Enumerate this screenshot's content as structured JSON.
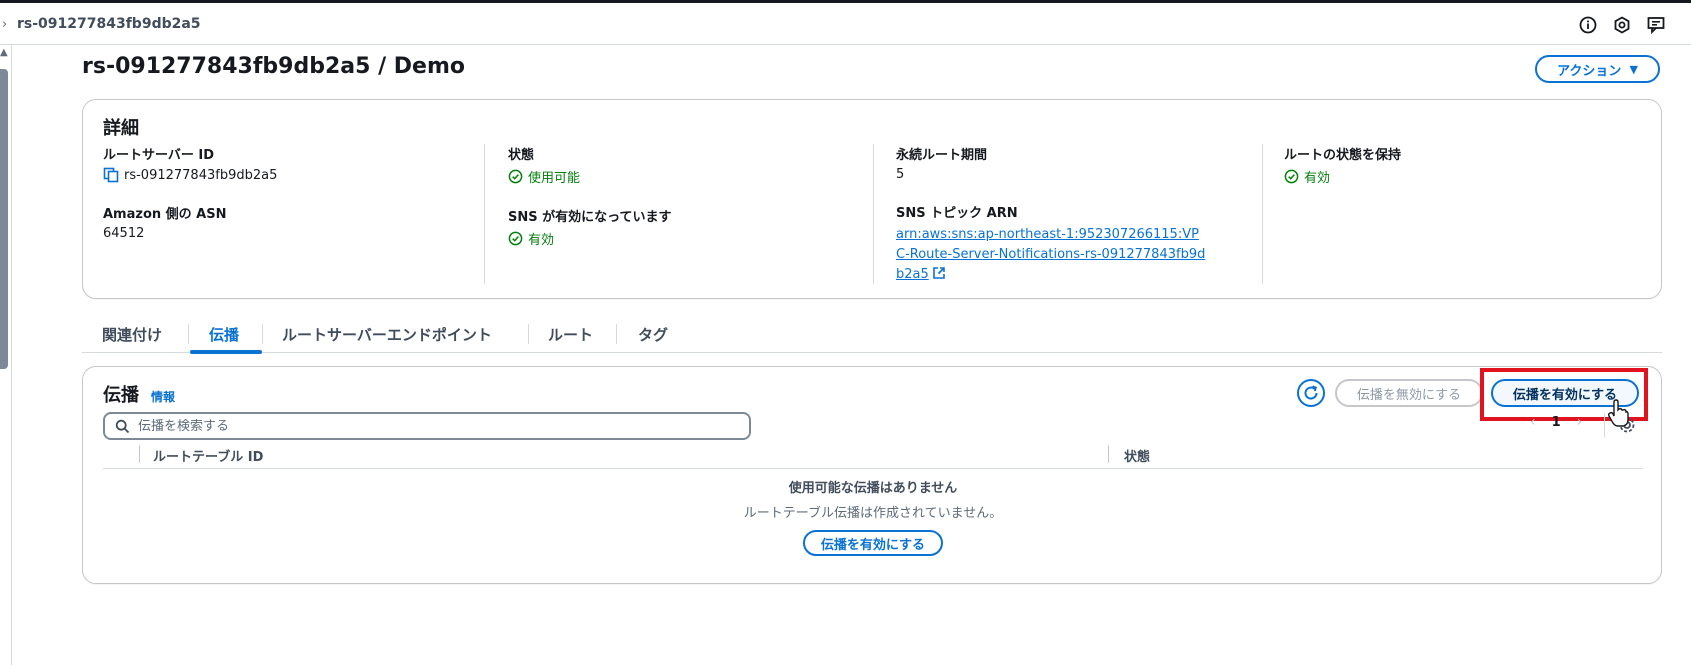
{
  "topbar": {
    "breadcrumb": "rs-091277843fb9db2a5",
    "icons": [
      "info-icon",
      "settings-icon",
      "feedback-icon"
    ]
  },
  "page": {
    "title": "rs-091277843fb9db2a5 / Demo",
    "action_label": "アクション"
  },
  "details": {
    "title": "詳細",
    "fields": {
      "route_server_id": {
        "label": "ルートサーバー ID",
        "value": "rs-091277843fb9db2a5"
      },
      "amazon_asn": {
        "label": "Amazon 側の ASN",
        "value": "64512"
      },
      "state": {
        "label": "状態",
        "value": "使用可能"
      },
      "sns_enabled": {
        "label": "SNS が有効になっています",
        "value": "有効"
      },
      "persist_period": {
        "label": "永続ルート期間",
        "value": "5"
      },
      "sns_topic_arn": {
        "label": "SNS トピック ARN",
        "value": "arn:aws:sns:ap-northeast-1:952307266115:VPC-Route-Server-Notifications-rs-091277843fb9db2a5"
      },
      "keep_route_state": {
        "label": "ルートの状態を保持",
        "value": "有効"
      }
    }
  },
  "tabs": [
    "関連付け",
    "伝播",
    "ルートサーバーエンドポイント",
    "ルート",
    "タグ"
  ],
  "active_tab": "伝播",
  "propagation": {
    "title": "伝播",
    "info_label": "情報",
    "disable_label": "伝播を無効にする",
    "enable_label": "伝播を有効にする",
    "search_placeholder": "伝播を検索する",
    "page_number": "1",
    "columns": [
      "ルートテーブル ID",
      "状態"
    ],
    "empty_title": "使用可能な伝播はありません",
    "empty_subtitle": "ルートテーブル伝播は作成されていません。",
    "empty_button": "伝播を有効にする"
  },
  "colors": {
    "accent": "#0972d3",
    "success": "#037f0c",
    "highlight": "#e0131e"
  }
}
